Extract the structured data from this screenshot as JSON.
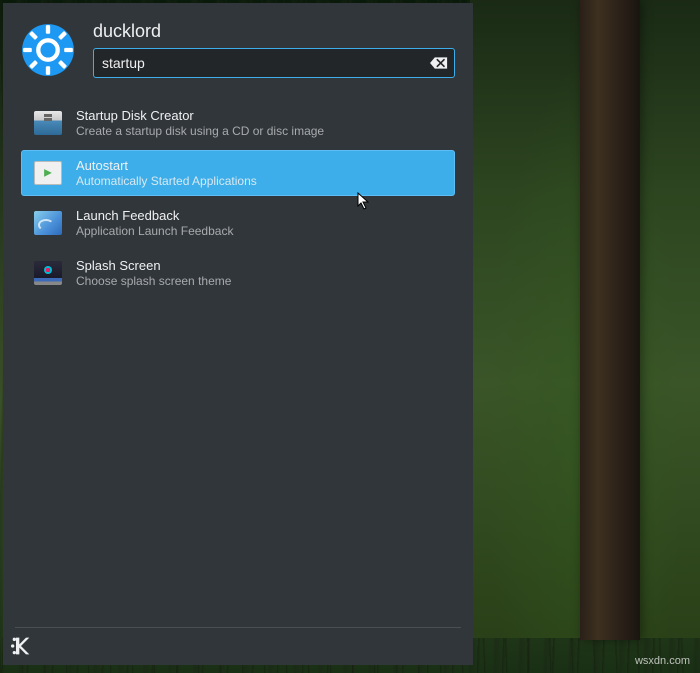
{
  "header": {
    "username": "ducklord"
  },
  "search": {
    "value": "startup"
  },
  "results": [
    {
      "title": "Startup Disk Creator",
      "description": "Create a startup disk using a CD or disc image",
      "icon": "usb-creator",
      "selected": false
    },
    {
      "title": "Autostart",
      "description": "Automatically Started Applications",
      "icon": "autostart",
      "selected": true
    },
    {
      "title": "Launch Feedback",
      "description": "Application Launch Feedback",
      "icon": "launch-feedback",
      "selected": false
    },
    {
      "title": "Splash Screen",
      "description": "Choose splash screen theme",
      "icon": "splash-screen",
      "selected": false
    }
  ],
  "watermark": "wsxdn.com"
}
